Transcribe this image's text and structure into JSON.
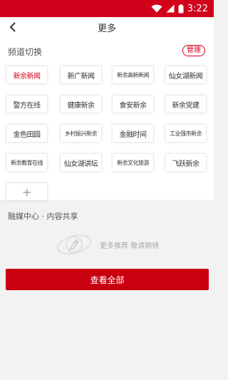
{
  "status": {
    "time": "3:22"
  },
  "header": {
    "title": "更多"
  },
  "panel": {
    "title": "频道切换",
    "manage_label": "管理",
    "channels": [
      "新余新闻",
      "新广新闻",
      "新余高新新闻",
      "仙女湖新闻",
      "警方在线",
      "健康新余",
      "食安新余",
      "新余党建",
      "金色田园",
      "乡村振兴新余",
      "金融时间",
      "工业强市新余",
      "新余教育在线",
      "仙女湖讲坛",
      "新余文化旅游",
      "飞跃新余"
    ],
    "add_label": "+"
  },
  "share": {
    "title": "融媒中心 · 内容共享",
    "empty_text": "更多推荐 敬请期待"
  },
  "actions": {
    "view_all_label": "查看全部"
  },
  "colors": {
    "brand_red": "#d1001b",
    "button_red": "#c8000f"
  },
  "icons": [
    "wifi-icon",
    "signal-icon",
    "battery-icon",
    "back-arrow-icon",
    "rocket-icon"
  ]
}
